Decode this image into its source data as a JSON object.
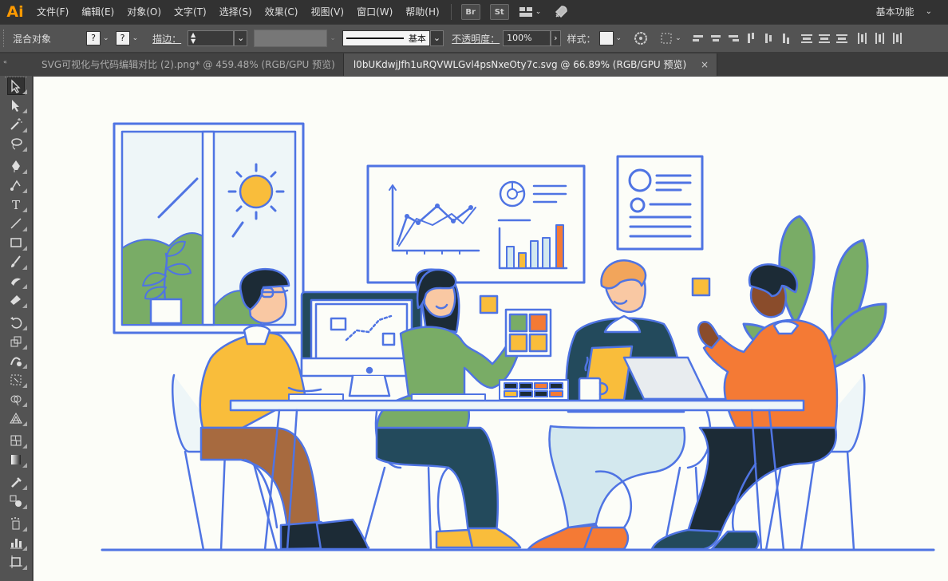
{
  "app": {
    "logo": "Ai"
  },
  "menu": {
    "items": [
      "文件(F)",
      "编辑(E)",
      "对象(O)",
      "文字(T)",
      "选择(S)",
      "效果(C)",
      "视图(V)",
      "窗口(W)",
      "帮助(H)"
    ],
    "bridge": "Br",
    "stock": "St",
    "workspace": "基本功能"
  },
  "control": {
    "selection_label": "混合对象",
    "fill_value": "?",
    "stroke_value": "?",
    "stroke_label": "描边：",
    "stroke_weight": "",
    "brush_label": "基本",
    "opacity_label": "不透明度：",
    "opacity_value": "100%",
    "style_label": "样式："
  },
  "tabs": [
    {
      "label": "SVG可视化与代码编辑对比 (2).png* @ 459.48% (RGB/GPU 预览)",
      "active": false
    },
    {
      "label": "l0bUKdwjJfh1uRQVWLGvl4psNxeOty7c.svg @ 66.89% (RGB/GPU 预览)",
      "active": true
    }
  ],
  "close_glyph": "×",
  "tools": [
    {
      "name": "selection-tool-icon",
      "active": true
    },
    {
      "name": "direct-selection-tool-icon"
    },
    {
      "name": "magic-wand-tool-icon"
    },
    {
      "name": "lasso-tool-icon"
    },
    {
      "name": "pen-tool-icon"
    },
    {
      "name": "curvature-tool-icon"
    },
    {
      "name": "type-tool-icon",
      "glyph": "T"
    },
    {
      "name": "line-segment-tool-icon"
    },
    {
      "name": "rectangle-tool-icon"
    },
    {
      "name": "paintbrush-tool-icon"
    },
    {
      "name": "shaper-tool-icon"
    },
    {
      "name": "eraser-tool-icon"
    },
    {
      "name": "rotate-tool-icon"
    },
    {
      "name": "scale-tool-icon"
    },
    {
      "name": "warp-tool-icon"
    },
    {
      "name": "free-transform-tool-icon"
    },
    {
      "name": "shape-builder-tool-icon"
    },
    {
      "name": "perspective-grid-tool-icon"
    },
    {
      "name": "mesh-tool-icon"
    },
    {
      "name": "gradient-tool-icon"
    },
    {
      "name": "eyedropper-tool-icon"
    },
    {
      "name": "blend-tool-icon"
    },
    {
      "name": "symbol-sprayer-tool-icon"
    },
    {
      "name": "column-graph-tool-icon"
    },
    {
      "name": "artboard-tool-icon"
    }
  ],
  "colors": {
    "outline": "#4f74e3",
    "yellow": "#f9bd3b",
    "orange": "#f47a35",
    "green": "#79ac66",
    "navy": "#234a5c",
    "brown": "#a76a3f",
    "light_blue": "#d3e8ee",
    "background": "#fcfdf8"
  }
}
